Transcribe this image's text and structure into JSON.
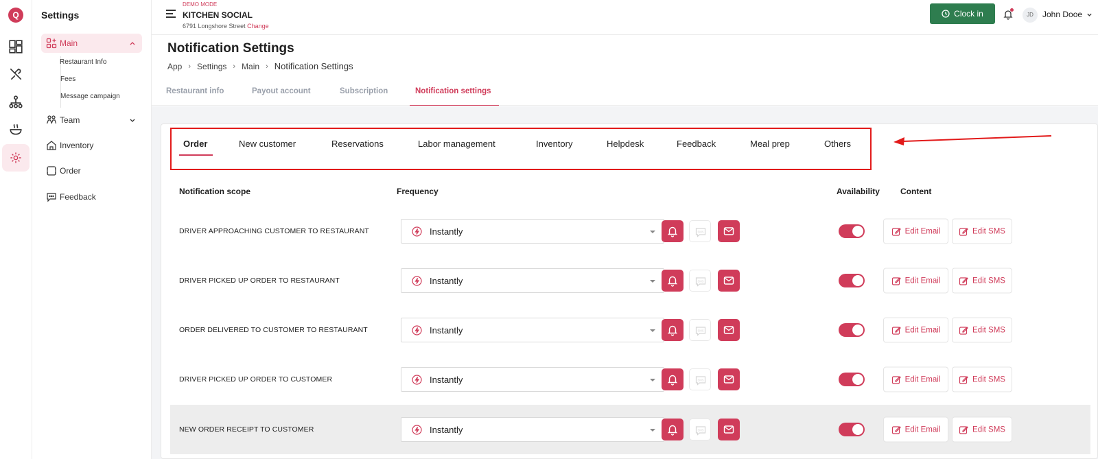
{
  "rail": {
    "logo": "Q"
  },
  "sidebar": {
    "title": "Settings",
    "items": [
      {
        "label": "Main",
        "sub": [
          "Restaurant Info",
          "Fees",
          "Message campaign"
        ]
      },
      {
        "label": "Team"
      },
      {
        "label": "Inventory"
      },
      {
        "label": "Order"
      },
      {
        "label": "Feedback"
      }
    ]
  },
  "topbar": {
    "demo": "DEMO MODE",
    "brand": "KITCHEN SOCIAL",
    "address": "6791 Longshore Street",
    "change": "Change",
    "clockin": "Clock in",
    "avatar": "JD",
    "user": "John Dooe"
  },
  "page": {
    "title": "Notification Settings",
    "breadcrumb": [
      "App",
      "Settings",
      "Main",
      "Notification Settings"
    ],
    "tabs": [
      "Restaurant info",
      "Payout account",
      "Subscription",
      "Notification settings"
    ]
  },
  "subtabs": [
    "Order",
    "New customer",
    "Reservations",
    "Labor management",
    "Inventory",
    "Helpdesk",
    "Feedback",
    "Meal prep",
    "Others"
  ],
  "table": {
    "headers": [
      "Notification scope",
      "Frequency",
      "Availability",
      "Content"
    ],
    "rows": [
      {
        "scope": "DRIVER APPROACHING CUSTOMER TO RESTAURANT",
        "frequency": "Instantly"
      },
      {
        "scope": "DRIVER PICKED UP ORDER TO RESTAURANT",
        "frequency": "Instantly"
      },
      {
        "scope": "ORDER DELIVERED TO CUSTOMER TO RESTAURANT",
        "frequency": "Instantly"
      },
      {
        "scope": "DRIVER PICKED UP ORDER TO CUSTOMER",
        "frequency": "Instantly"
      },
      {
        "scope": "NEW ORDER RECEIPT TO CUSTOMER",
        "frequency": "Instantly"
      }
    ],
    "edit_email": "Edit Email",
    "edit_sms": "Edit SMS"
  },
  "colors": {
    "accent": "#d03c5a",
    "clockin": "#2e7d4f",
    "annotation": "#e21a1a"
  },
  "icons": {
    "bell": "bell-icon",
    "sms": "sms-icon",
    "mail": "mail-icon",
    "bolt": "bolt-icon",
    "edit": "edit-icon"
  }
}
